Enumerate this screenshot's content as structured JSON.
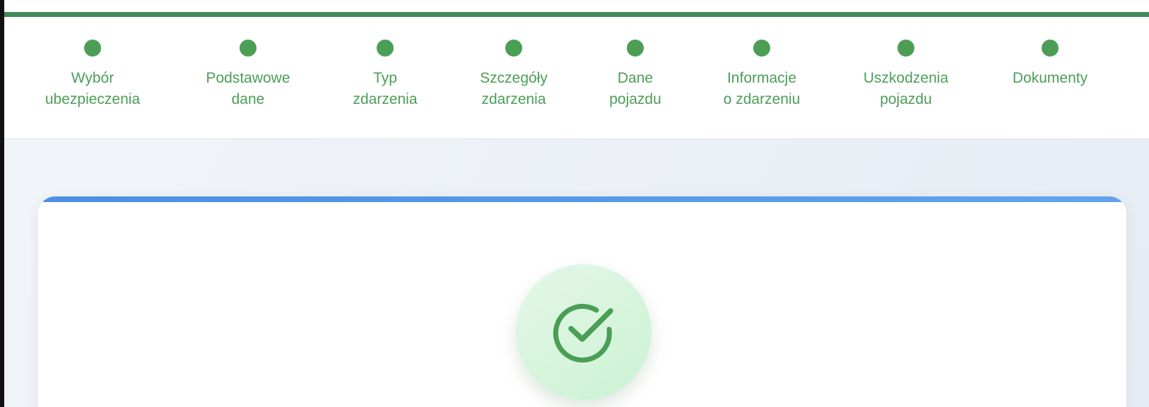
{
  "steps": [
    {
      "label": "Wybór\nubezpieczenia"
    },
    {
      "label": "Podstawowe\ndane"
    },
    {
      "label": "Typ\nzdarzenia"
    },
    {
      "label": "Szczegóły\nzdarzenia"
    },
    {
      "label": "Dane\npojazdu"
    },
    {
      "label": "Informacje\no zdarzeniu"
    },
    {
      "label": "Uszkodzenia\npojazdu"
    },
    {
      "label": "Dokumenty"
    }
  ],
  "colors": {
    "progress": "#3f8a5a",
    "step_dot": "#4c9e57",
    "step_text": "#4b9e57",
    "card_accent": "#4b8fe3",
    "success": "#4a9e55"
  },
  "icons": {
    "success": "check-circle-icon"
  }
}
